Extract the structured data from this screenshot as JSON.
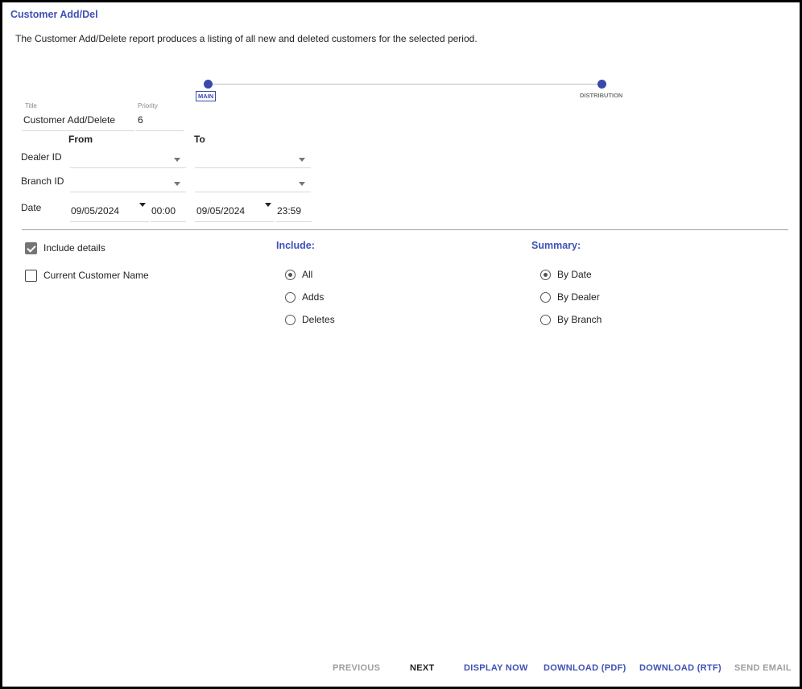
{
  "page": {
    "title": "Customer Add/Del",
    "description": "The Customer Add/Delete report produces a listing of all new and deleted customers for the selected period."
  },
  "stepper": {
    "steps": [
      {
        "label": "MAIN",
        "active": true
      },
      {
        "label": "DISTRIBUTION",
        "active": false
      }
    ]
  },
  "form": {
    "title_label": "Title",
    "title_value": "Customer Add/Delete",
    "priority_label": "Priority",
    "priority_value": "6",
    "from_label": "From",
    "to_label": "To",
    "dealer_label": "Dealer ID",
    "dealer_from": "",
    "dealer_to": "",
    "branch_label": "Branch ID",
    "branch_from": "",
    "branch_to": "",
    "date_label": "Date",
    "date_from": "09/05/2024",
    "time_from": "00:00",
    "date_to": "09/05/2024",
    "time_to": "23:59"
  },
  "options": {
    "include_details_label": "Include details",
    "include_details_checked": true,
    "current_name_label": "Current Customer Name",
    "current_name_checked": false
  },
  "include": {
    "heading": "Include:",
    "items": [
      {
        "label": "All",
        "checked": true
      },
      {
        "label": "Adds",
        "checked": false
      },
      {
        "label": "Deletes",
        "checked": false
      }
    ]
  },
  "summary": {
    "heading": "Summary:",
    "items": [
      {
        "label": "By Date",
        "checked": true
      },
      {
        "label": "By Dealer",
        "checked": false
      },
      {
        "label": "By Branch",
        "checked": false
      }
    ]
  },
  "footer": {
    "previous": "PREVIOUS",
    "next": "NEXT",
    "display_now": "DISPLAY NOW",
    "download_pdf": "DOWNLOAD (PDF)",
    "download_rtf": "DOWNLOAD (RTF)",
    "send_email": "SEND EMAIL"
  },
  "colors": {
    "accent": "#3f51b5",
    "stepper": "#3949ab",
    "disabled": "#9e9e9e"
  }
}
